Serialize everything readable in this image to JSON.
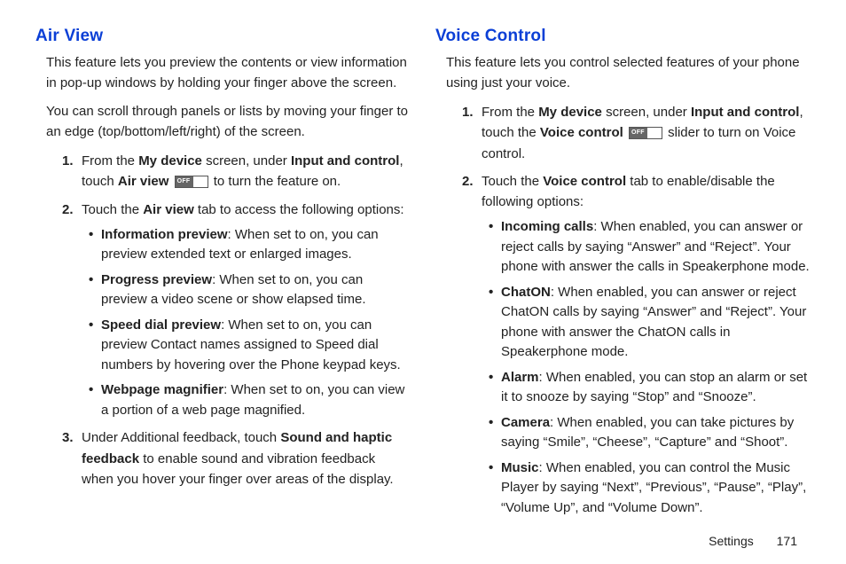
{
  "left": {
    "heading": "Air View",
    "intro1": "This feature lets you preview the contents or view information in pop-up windows by holding your finger above the screen.",
    "intro2": "You can scroll through panels or lists by moving your finger to an edge (top/bottom/left/right) of the screen.",
    "step1": {
      "t1": "From the ",
      "b1": "My device",
      "t2": " screen, under ",
      "b2": "Input and control",
      "t3": ", touch ",
      "b3": "Air view",
      "t4": " to turn the feature on."
    },
    "step2": {
      "t1": "Touch the ",
      "b1": "Air view",
      "t2": " tab to access the following options:"
    },
    "bullets": {
      "b1": {
        "name": "Information preview",
        "desc": ": When set to on, you can preview extended text or enlarged images."
      },
      "b2": {
        "name": "Progress preview",
        "desc": ": When set to on, you can preview a video scene or show elapsed time."
      },
      "b3": {
        "name": "Speed dial preview",
        "desc": ": When set to on, you can preview Contact names assigned to Speed dial numbers by hovering over the Phone keypad keys."
      },
      "b4": {
        "name": "Webpage magnifier",
        "desc": ": When set to on, you can view a portion of a web page magnified."
      }
    },
    "step3": {
      "t1": "Under Additional feedback, touch ",
      "b1": "Sound and haptic feedback",
      "t2": " to enable sound and vibration feedback when you hover your finger over areas of the display."
    }
  },
  "right": {
    "heading": "Voice Control",
    "intro1": "This feature lets you control selected features of your phone using just your voice.",
    "step1": {
      "t1": "From the ",
      "b1": "My device",
      "t2": " screen, under ",
      "b2": "Input and control",
      "t3": ", touch the ",
      "b3": "Voice control",
      "t4": " slider to turn on Voice control."
    },
    "step2": {
      "t1": "Touch the ",
      "b1": "Voice control",
      "t2": " tab to enable/disable the following options:"
    },
    "bullets": {
      "b1": {
        "name": "Incoming calls",
        "desc": ": When enabled, you can answer or reject calls by saying “Answer” and “Reject”. Your phone with answer the calls in Speakerphone mode."
      },
      "b2": {
        "name": "ChatON",
        "desc": ": When enabled, you can answer or reject ChatON calls by saying “Answer” and “Reject”. Your phone with answer the ChatON calls in Speakerphone mode."
      },
      "b3": {
        "name": "Alarm",
        "desc": ": When enabled, you can stop an alarm or set it to snooze by saying “Stop” and “Snooze”."
      },
      "b4": {
        "name": "Camera",
        "desc": ": When enabled, you can take pictures by saying “Smile”, “Cheese”, “Capture” and “Shoot”."
      },
      "b5": {
        "name": "Music",
        "desc": ": When enabled, you can control the Music Player by saying “Next”, “Previous”, “Pause”, “Play”, “Volume Up”, and “Volume Down”."
      }
    }
  },
  "footer": {
    "section": "Settings",
    "page": "171"
  }
}
